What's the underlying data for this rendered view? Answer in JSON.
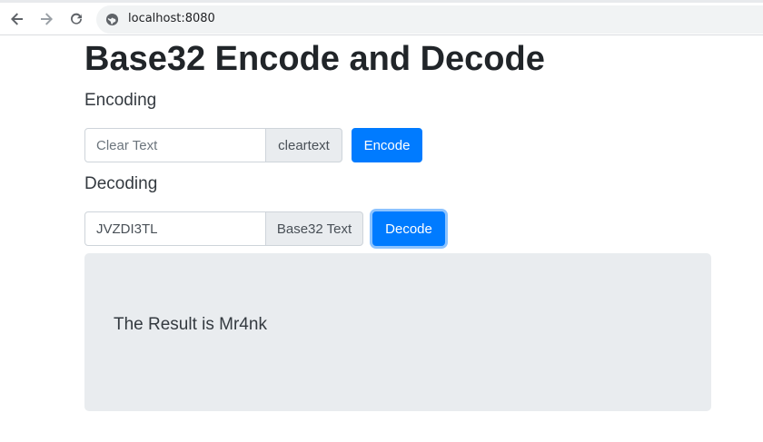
{
  "browser": {
    "url": "localhost:8080"
  },
  "page": {
    "title": "Base32 Encode and Decode",
    "encoding": {
      "label": "Encoding",
      "input_value": "",
      "input_placeholder": "Clear Text",
      "addon_text": "cleartext",
      "button_label": "Encode"
    },
    "decoding": {
      "label": "Decoding",
      "input_value": "JVZDI3TL",
      "input_placeholder": "",
      "addon_text": "Base32 Text",
      "button_label": "Decode"
    },
    "result": {
      "text": "The Result is Mr4nk"
    }
  },
  "colors": {
    "primary": "#007bff",
    "jumbotron": "#e9ecef"
  },
  "icons": [
    "back-arrow-icon",
    "forward-arrow-icon",
    "reload-icon",
    "site-info-icon"
  ]
}
